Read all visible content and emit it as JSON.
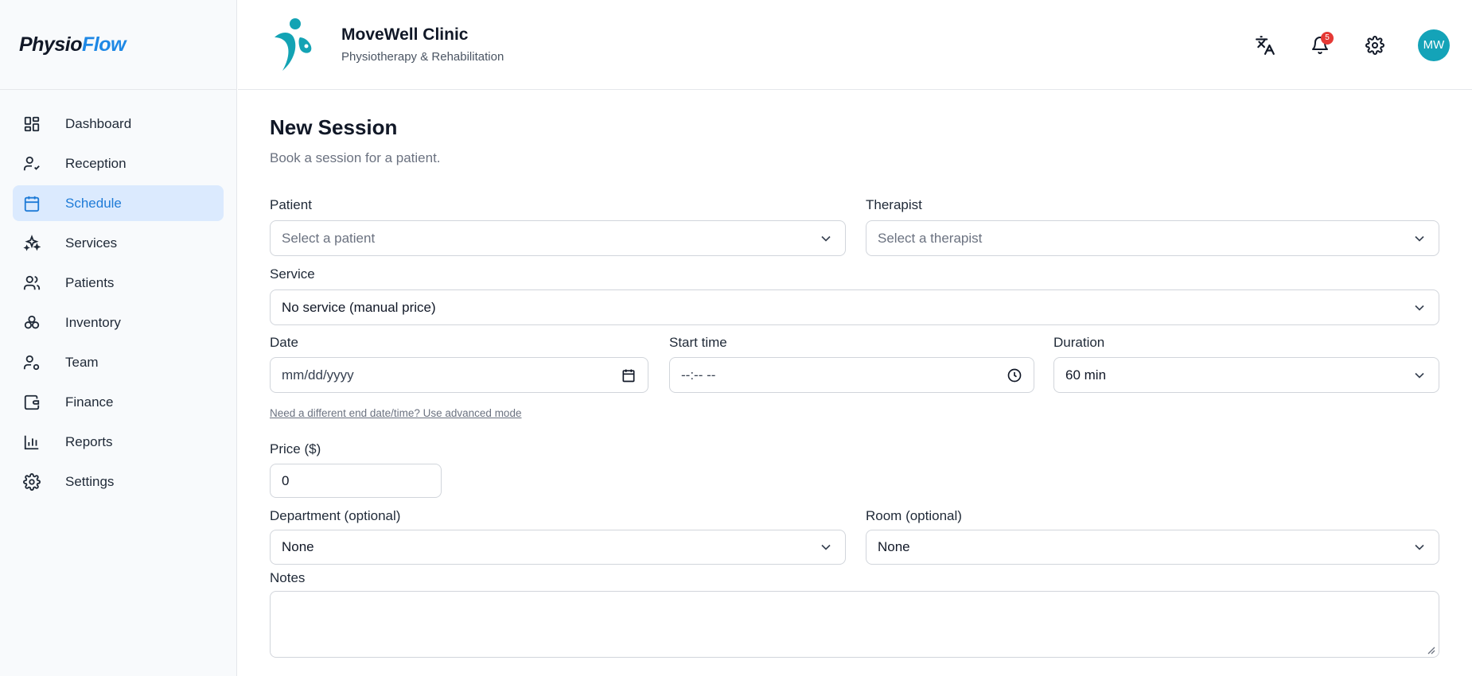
{
  "brand": {
    "part1": "Physio",
    "part2": "Flow"
  },
  "sidebar": {
    "items": [
      {
        "label": "Dashboard",
        "icon": "dashboard-icon"
      },
      {
        "label": "Reception",
        "icon": "user-check-icon"
      },
      {
        "label": "Schedule",
        "icon": "calendar-icon",
        "active": true
      },
      {
        "label": "Services",
        "icon": "sparkles-icon"
      },
      {
        "label": "Patients",
        "icon": "users-icon"
      },
      {
        "label": "Inventory",
        "icon": "boxes-icon"
      },
      {
        "label": "Team",
        "icon": "user-cog-icon"
      },
      {
        "label": "Finance",
        "icon": "wallet-icon"
      },
      {
        "label": "Reports",
        "icon": "bar-chart-icon"
      },
      {
        "label": "Settings",
        "icon": "gear-icon"
      }
    ]
  },
  "header": {
    "clinic_name": "MoveWell Clinic",
    "clinic_sub": "Physiotherapy & Rehabilitation",
    "notification_count": "5",
    "avatar_initials": "MW"
  },
  "page": {
    "title": "New Session",
    "subtitle": "Book a session for a patient."
  },
  "form": {
    "patient_label": "Patient",
    "patient_placeholder": "Select a patient",
    "therapist_label": "Therapist",
    "therapist_placeholder": "Select a therapist",
    "service_label": "Service",
    "service_value": "No service (manual price)",
    "date_label": "Date",
    "date_placeholder": "mm/dd/yyyy",
    "start_label": "Start time",
    "start_placeholder": "--:-- --",
    "duration_label": "Duration",
    "duration_value": "60 min",
    "advanced_link": "Need a different end date/time? Use advanced mode",
    "price_label": "Price ($)",
    "price_value": "0",
    "department_label": "Department (optional)",
    "department_value": "None",
    "room_label": "Room (optional)",
    "room_value": "None",
    "notes_label": "Notes",
    "notes_value": ""
  },
  "colors": {
    "accent": "#1e88e5",
    "active_bg": "#dbeafe",
    "avatar_bg": "#14a3b8",
    "badge": "#e53935",
    "logo_teal": "#13a3b4"
  }
}
